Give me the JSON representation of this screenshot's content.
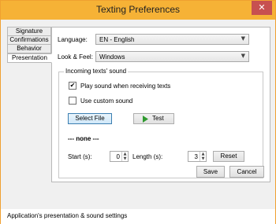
{
  "window": {
    "title": "Texting Preferences",
    "close_glyph": "✕"
  },
  "tabs": [
    {
      "label": "Signature"
    },
    {
      "label": "Confirmations"
    },
    {
      "label": "Behavior"
    },
    {
      "label": "Presentation"
    }
  ],
  "presentation": {
    "language_label": "Language:",
    "language_value": "EN - English",
    "look_label": "Look & Feel:",
    "look_value": "Windows",
    "group_title": "Incoming texts' sound",
    "play_sound_label": "Play sound when receiving texts",
    "play_sound_checked": true,
    "custom_sound_label": "Use custom sound",
    "custom_sound_checked": false,
    "select_file_label": "Select File",
    "test_label": "Test",
    "selected_file_text": "--- none ---",
    "start_label": "Start (s):",
    "start_value": "0",
    "length_label": "Length (s):",
    "length_value": "3",
    "reset_label": "Reset"
  },
  "footer": {
    "save_label": "Save",
    "cancel_label": "Cancel"
  },
  "status": {
    "text": "Application's presentation & sound settings"
  },
  "icons": {
    "checkmark": "✔",
    "dropdown": "▼",
    "spin_up": "▲",
    "spin_down": "▼",
    "play": "play-icon"
  },
  "colors": {
    "titlebar": "#f6b236",
    "close": "#c75050",
    "play_green": "#2f9a2f"
  }
}
